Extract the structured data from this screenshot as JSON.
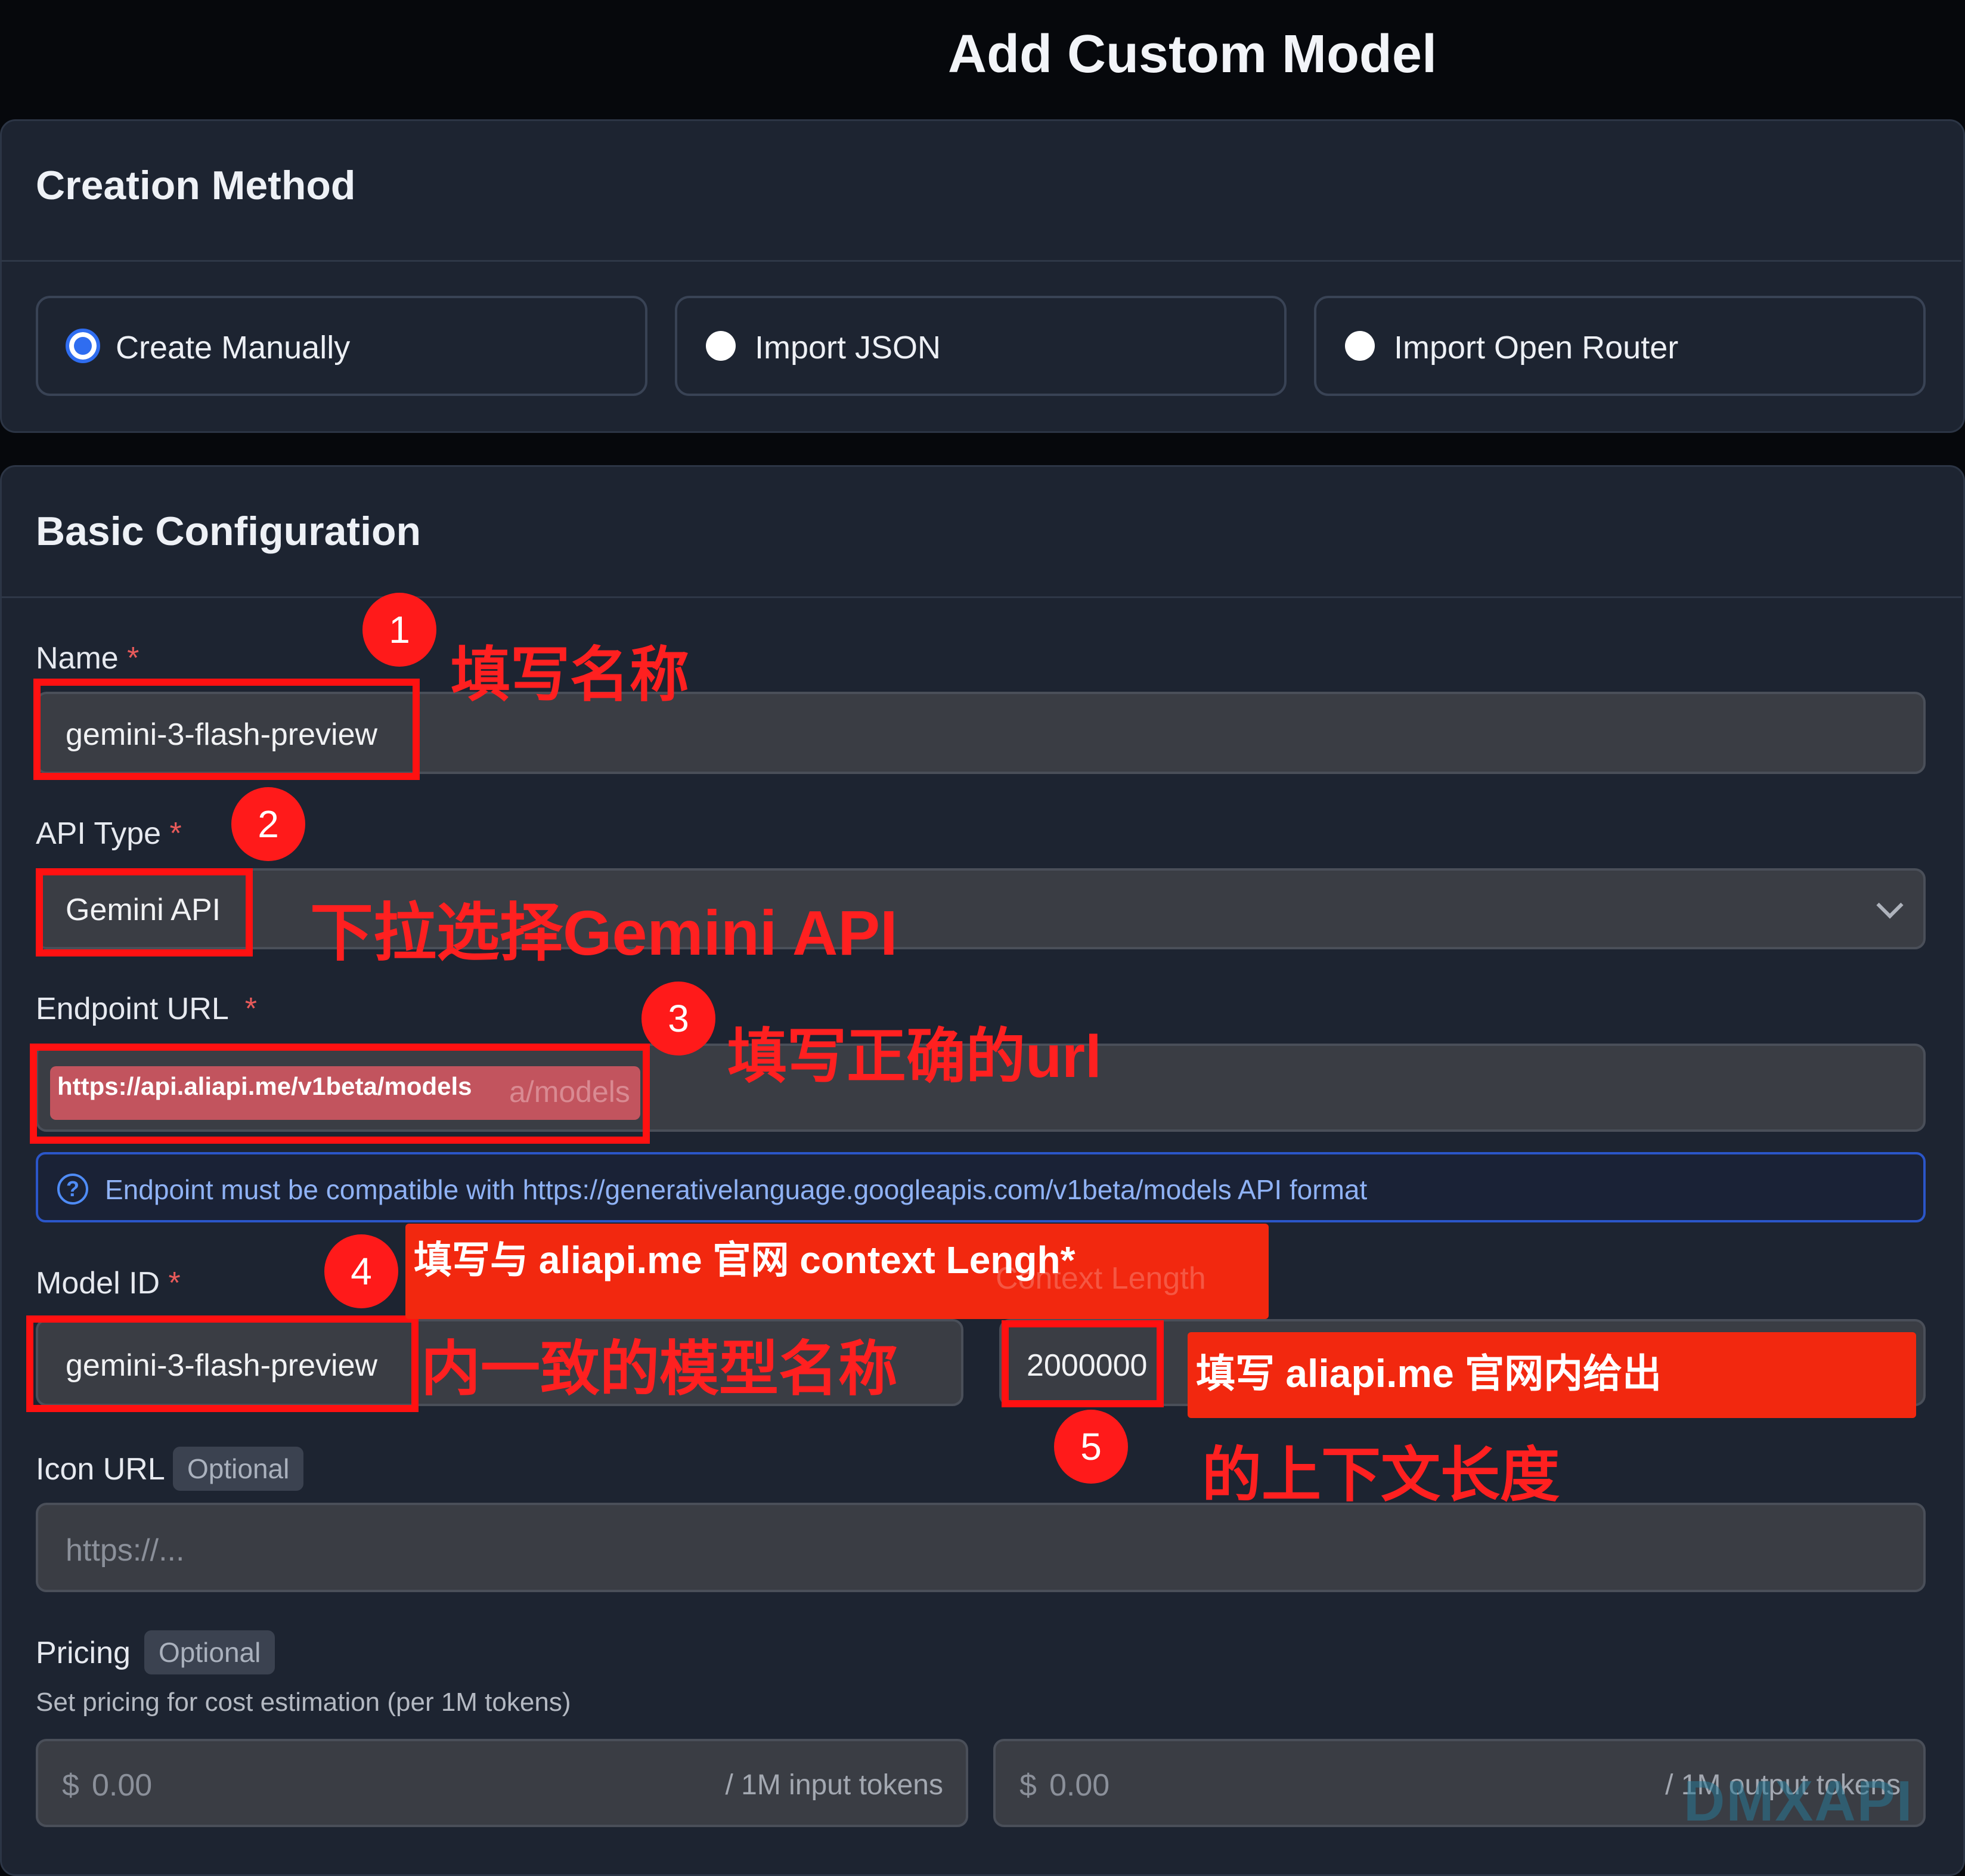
{
  "page_title": "Add Custom Model",
  "creation_method": {
    "title": "Creation Method",
    "options": [
      {
        "label": "Create Manually",
        "selected": true
      },
      {
        "label": "Import JSON",
        "selected": false
      },
      {
        "label": "Import Open Router",
        "selected": false
      }
    ]
  },
  "basic_config": {
    "title": "Basic Configuration",
    "required_mark": "*",
    "name": {
      "label": "Name",
      "value": "gemini-3-flash-preview"
    },
    "api_type": {
      "label": "API Type",
      "value": "Gemini API"
    },
    "endpoint": {
      "label": "Endpoint URL",
      "value": "https://api.aliapi.me/v1beta/models",
      "ghost": "a/models",
      "info": "Endpoint must be compatible with https://generativelanguage.googleapis.com/v1beta/models API format"
    },
    "model_id": {
      "label": "Model ID",
      "value": "gemini-3-flash-preview",
      "ghost_context": "Context Length"
    },
    "context_length": {
      "value": "2000000"
    },
    "icon_url": {
      "label": "Icon URL",
      "badge": "Optional",
      "placeholder": "https://..."
    },
    "pricing": {
      "label": "Pricing",
      "badge": "Optional",
      "description": "Set pricing for cost estimation (per 1M tokens)",
      "input": {
        "currency": "$",
        "placeholder": "0.00",
        "suffix": "/ 1M input tokens"
      },
      "output": {
        "currency": "$",
        "placeholder": "0.00",
        "suffix": "/ 1M output tokens"
      }
    }
  },
  "annotations": {
    "n1": "1",
    "t1": "填写名称",
    "n2": "2",
    "t2": "下拉选择Gemini API",
    "n3": "3",
    "t3": "填写正确的url",
    "n4": "4",
    "t4a": "填写与 aliapi.me 官网 context Lengh*",
    "t4b": "内一致的模型名称",
    "n5": "5",
    "t5a": "填写 aliapi.me 官网内给出",
    "t5b": "的上下文长度"
  },
  "watermark": "DMXAPI",
  "colors": {
    "accent": "#2f6df0",
    "annotation_red": "#ff1a1a",
    "card_bg": "#1d2431",
    "page_bg": "#06080c"
  }
}
